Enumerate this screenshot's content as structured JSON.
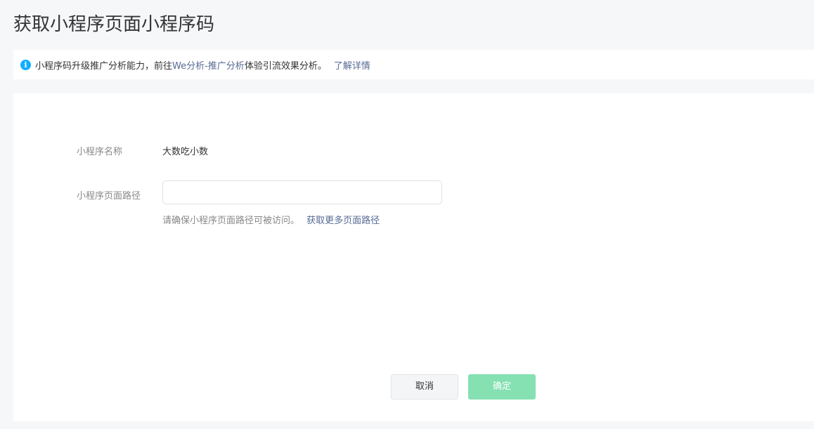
{
  "page": {
    "title": "获取小程序页面小程序码"
  },
  "notice": {
    "text_before": "小程序码升级推广分析能力，前往",
    "link_text": "We分析-推广分析",
    "text_after": "体验引流效果分析。",
    "more_link": "了解详情",
    "icon": "info-icon",
    "icon_glyph": "i"
  },
  "form": {
    "name_label": "小程序名称",
    "name_value": "大数吃小数",
    "path_label": "小程序页面路径",
    "path_value": "",
    "path_placeholder": "",
    "hint_text": "请确保小程序页面路径可被访问。",
    "hint_link": "获取更多页面路径"
  },
  "actions": {
    "cancel_label": "取消",
    "confirm_label": "确定"
  },
  "colors": {
    "link": "#576b95",
    "info_icon": "#10aeff",
    "confirm_disabled": "#85e0b2"
  }
}
